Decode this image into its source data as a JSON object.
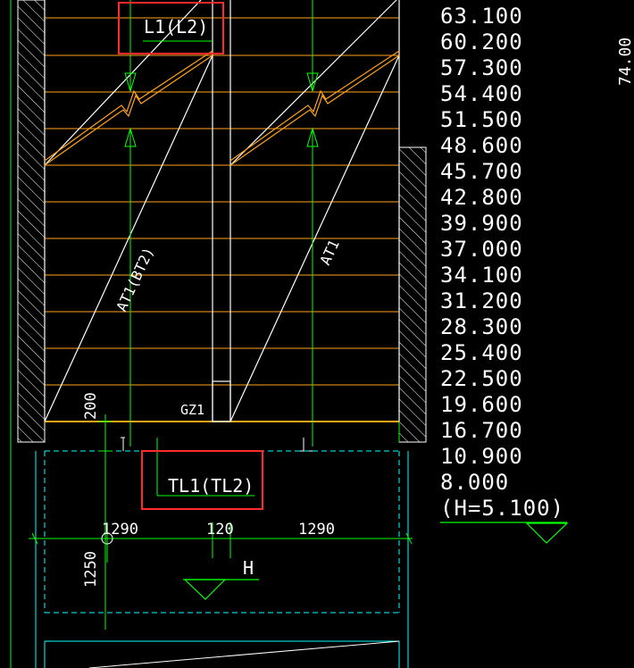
{
  "drawing": {
    "colors": {
      "background": "#000000",
      "stair_lines": "#ffa31a",
      "outline": "#ffffff",
      "dimension": "#00ff00",
      "axis": "#00ffff",
      "highlight_box": "#ff2a2a"
    },
    "labels": {
      "beam_top": "L1(L2)",
      "beam_bottom": "TL1(TL2)",
      "flight_left": "AT1(BT2)",
      "flight_right": "AT1",
      "column": "GZ1",
      "dim_200": "200",
      "dim_1290_left": "1290",
      "dim_120": "120",
      "dim_1290_right": "1290",
      "dim_1250": "1250",
      "level_mark": "H",
      "side_number": "74.00"
    },
    "elevations": [
      "63.100",
      "60.200",
      "57.300",
      "54.400",
      "51.500",
      "48.600",
      "45.700",
      "42.800",
      "39.900",
      "37.000",
      "34.100",
      "31.200",
      "28.300",
      "25.400",
      "22.500",
      "19.600",
      "16.700",
      "10.900",
      "8.000",
      "(H=5.100)"
    ]
  }
}
